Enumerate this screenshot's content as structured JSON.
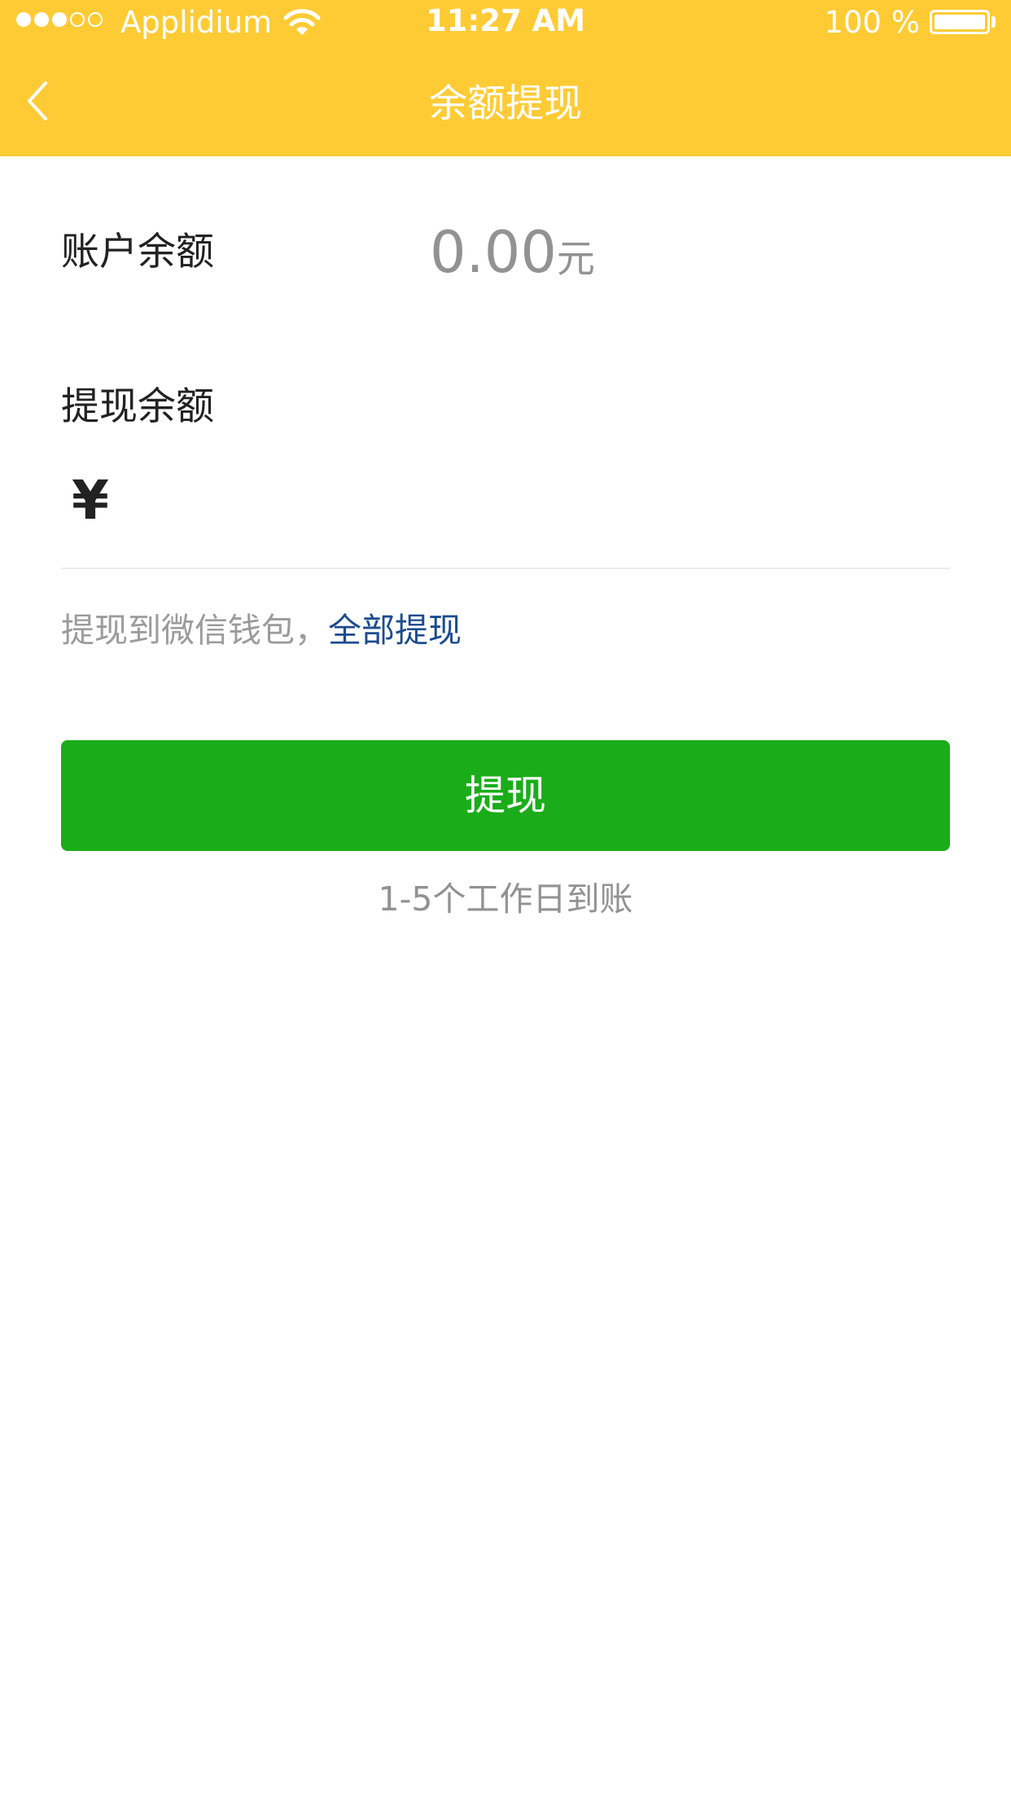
{
  "status_bar": {
    "carrier": "Applidium",
    "time": "11:27 AM",
    "battery": "100 %",
    "signal_bars_filled": 3,
    "signal_bars_total": 5
  },
  "nav": {
    "title": "余额提现",
    "back_icon": "chevron-left-icon"
  },
  "account": {
    "label": "账户余额",
    "amount": "0.00",
    "unit": "元"
  },
  "withdraw": {
    "label": "提现余额",
    "currency_symbol": "¥",
    "input_value": "",
    "hint": "提现到微信钱包，",
    "withdraw_all_link": "全部提现"
  },
  "submit": {
    "label": "提现"
  },
  "note": "1-5个工作日到账",
  "colors": {
    "header": "#ffcb35",
    "button": "#1aad19",
    "link": "#1d4b8e"
  }
}
